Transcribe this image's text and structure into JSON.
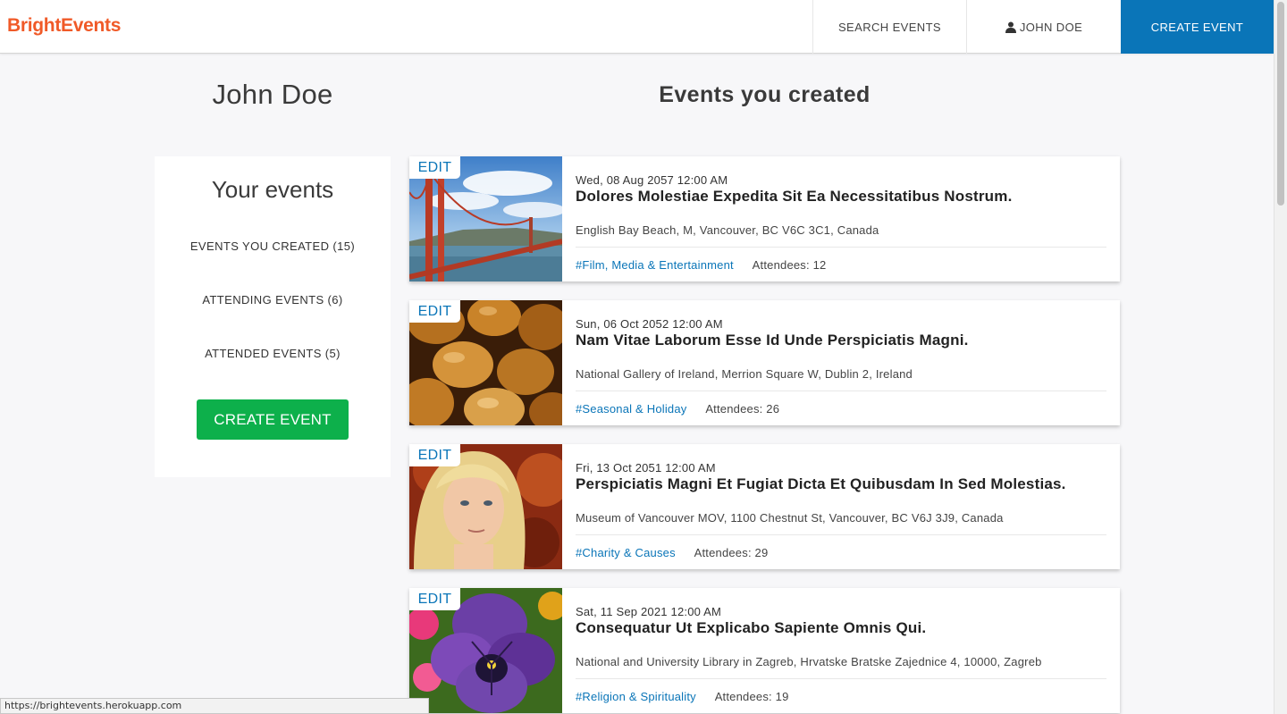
{
  "brand": "BrightEvents",
  "nav": {
    "search": "SEARCH EVENTS",
    "user": "JOHN DOE",
    "create": "CREATE EVENT"
  },
  "profile": {
    "name": "John Doe"
  },
  "section_title": "Events you created",
  "sidebar": {
    "title": "Your events",
    "links": [
      "EVENTS YOU CREATED (15)",
      "ATTENDING EVENTS (6)",
      "ATTENDED EVENTS (5)"
    ],
    "create_button": "CREATE EVENT"
  },
  "events": [
    {
      "edit": "EDIT",
      "date": "Wed, 08 Aug 2057 12:00 AM",
      "title": "Dolores Molestiae Expedita Sit Ea Necessitatibus Nostrum.",
      "location": "English Bay Beach, M, Vancouver, BC V6C 3C1, Canada",
      "category": "#Film, Media & Entertainment",
      "attendees": "Attendees: 12"
    },
    {
      "edit": "EDIT",
      "date": "Sun, 06 Oct 2052 12:00 AM",
      "title": "Nam Vitae Laborum Esse Id Unde Perspiciatis Magni.",
      "location": "National Gallery of Ireland, Merrion Square W, Dublin 2, Ireland",
      "category": "#Seasonal & Holiday",
      "attendees": "Attendees: 26"
    },
    {
      "edit": "EDIT",
      "date": "Fri, 13 Oct 2051 12:00 AM",
      "title": "Perspiciatis Magni Et Fugiat Dicta Et Quibusdam In Sed Molestias.",
      "location": "Museum of Vancouver MOV, 1100 Chestnut St, Vancouver, BC V6J 3J9, Canada",
      "category": "#Charity & Causes",
      "attendees": "Attendees: 29"
    },
    {
      "edit": "EDIT",
      "date": "Sat, 11 Sep 2021 12:00 AM",
      "title": "Consequatur Ut Explicabo Sapiente Omnis Qui.",
      "location": "National and University Library in Zagreb, Hrvatske Bratske Zajednice 4, 10000, Zagreb",
      "category": "#Religion & Spirituality",
      "attendees": "Attendees: 19"
    }
  ],
  "status_url": "https://brightevents.herokuapp.com",
  "colors": {
    "brand": "#f05a28",
    "primary": "#0a75b8",
    "success": "#0db04b",
    "background": "#f7f7f9"
  }
}
